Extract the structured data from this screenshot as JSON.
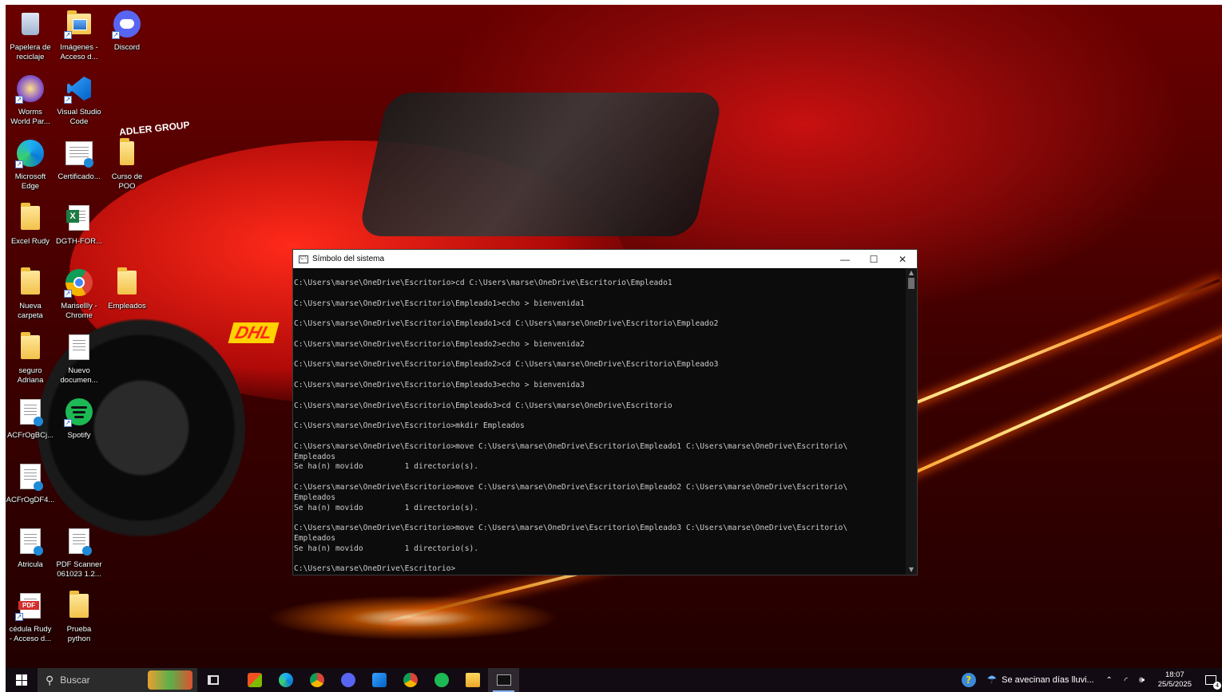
{
  "desktop": {
    "icons": [
      {
        "label": "Papelera de\nreciclaje",
        "icon": "recycle-bin-icon"
      },
      {
        "label": "Imágenes -\nAcceso d...",
        "icon": "pictures-folder-icon"
      },
      {
        "label": "Discord",
        "icon": "discord-icon"
      },
      {
        "label": "Worms\nWorld Par...",
        "icon": "worms-game-icon"
      },
      {
        "label": "Visual Studio\nCode",
        "icon": "vscode-icon"
      },
      {
        "label": "Microsoft\nEdge",
        "icon": "edge-icon"
      },
      {
        "label": "Certificado...",
        "icon": "document-icon"
      },
      {
        "label": "Curso de\nPOO",
        "icon": "folder-icon"
      },
      {
        "label": "Excel Rudy",
        "icon": "folder-icon"
      },
      {
        "label": "DGTH-FOR...",
        "icon": "excel-file-icon"
      },
      {
        "label": "Nueva\ncarpeta",
        "icon": "folder-icon"
      },
      {
        "label": "Marisellly -\nChrome",
        "icon": "chrome-icon"
      },
      {
        "label": "Empleados",
        "icon": "folder-icon"
      },
      {
        "label": "seguro\nAdriana",
        "icon": "folder-icon"
      },
      {
        "label": "Nuevo\ndocumen...",
        "icon": "text-document-icon"
      },
      {
        "label": "ACFrOgBCj...",
        "icon": "document-icon"
      },
      {
        "label": "Spotify",
        "icon": "spotify-icon"
      },
      {
        "label": "ACFrOgDF4...",
        "icon": "document-icon"
      },
      {
        "label": "Atricula",
        "icon": "document-icon"
      },
      {
        "label": "PDF Scanner\n061023 1.2...",
        "icon": "document-icon"
      },
      {
        "label": "cédula Rudy\n- Acceso d...",
        "icon": "pdf-icon"
      },
      {
        "label": "Prueba\npython",
        "icon": "folder-icon"
      }
    ]
  },
  "cmd": {
    "title": "Símbolo del sistema",
    "minimize_glyph": "—",
    "maximize_glyph": "☐",
    "close_glyph": "✕",
    "output": "C:\\Users\\marse\\OneDrive\\Escritorio>cd C:\\Users\\marse\\OneDrive\\Escritorio\\Empleado1\n\nC:\\Users\\marse\\OneDrive\\Escritorio\\Empleado1>echo > bienvenida1\n\nC:\\Users\\marse\\OneDrive\\Escritorio\\Empleado1>cd C:\\Users\\marse\\OneDrive\\Escritorio\\Empleado2\n\nC:\\Users\\marse\\OneDrive\\Escritorio\\Empleado2>echo > bienvenida2\n\nC:\\Users\\marse\\OneDrive\\Escritorio\\Empleado2>cd C:\\Users\\marse\\OneDrive\\Escritorio\\Empleado3\n\nC:\\Users\\marse\\OneDrive\\Escritorio\\Empleado3>echo > bienvenida3\n\nC:\\Users\\marse\\OneDrive\\Escritorio\\Empleado3>cd C:\\Users\\marse\\OneDrive\\Escritorio\n\nC:\\Users\\marse\\OneDrive\\Escritorio>mkdir Empleados\n\nC:\\Users\\marse\\OneDrive\\Escritorio>move C:\\Users\\marse\\OneDrive\\Escritorio\\Empleado1 C:\\Users\\marse\\OneDrive\\Escritorio\\\nEmpleados\nSe ha(n) movido         1 directorio(s).\n\nC:\\Users\\marse\\OneDrive\\Escritorio>move C:\\Users\\marse\\OneDrive\\Escritorio\\Empleado2 C:\\Users\\marse\\OneDrive\\Escritorio\\\nEmpleados\nSe ha(n) movido         1 directorio(s).\n\nC:\\Users\\marse\\OneDrive\\Escritorio>move C:\\Users\\marse\\OneDrive\\Escritorio\\Empleado3 C:\\Users\\marse\\OneDrive\\Escritorio\\\nEmpleados\nSe ha(n) movido         1 directorio(s).\n\nC:\\Users\\marse\\OneDrive\\Escritorio>"
  },
  "wallpaper": {
    "brand_text": "ADLER GROUP",
    "dhl_text": "DHL"
  },
  "taskbar": {
    "search_placeholder": "Buscar",
    "weather_text": "Se avecinan días lluvi...",
    "time": "18:07",
    "date": "25/5/2025",
    "notification_count": "4",
    "apps": [
      "task-view-icon",
      "store-icon",
      "edge-icon",
      "chrome-icon",
      "discord-icon",
      "vscode-icon",
      "chrome-profile-icon",
      "spotify-icon",
      "file-explorer-icon",
      "terminal-icon"
    ]
  },
  "colors": {
    "cmd_bg": "#0c0c0c",
    "cmd_text": "#cccccc",
    "taskbar_bg": "#120c14",
    "accent": "#8ab4f8"
  }
}
